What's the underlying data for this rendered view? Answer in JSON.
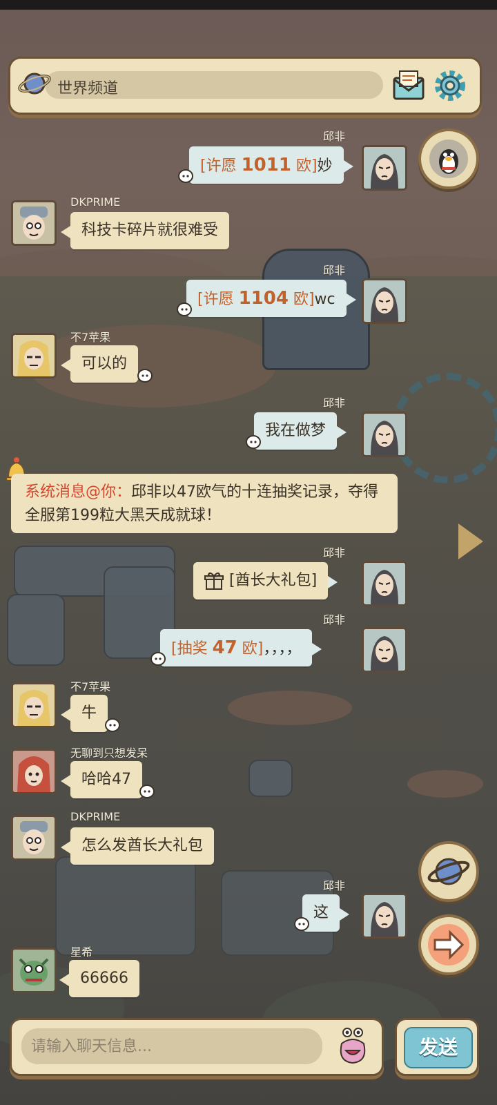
{
  "header": {
    "channel": "世界频道"
  },
  "messages": [
    {
      "sender": "邱非",
      "mine": true,
      "tag_open": "[许愿 ",
      "amount": "1011",
      "tag_close": " 欧]",
      "text": "妙"
    },
    {
      "sender": "DKPRIME",
      "mine": false,
      "text": "科技卡碎片就很难受"
    },
    {
      "sender": "邱非",
      "mine": true,
      "tag_open": "[许愿 ",
      "amount": "1104",
      "tag_close": " 欧]",
      "text": "wc"
    },
    {
      "sender": "不7苹果",
      "mine": false,
      "text": "可以的"
    },
    {
      "sender": "邱非",
      "mine": true,
      "text": "我在做梦"
    },
    {
      "sender": "邱非",
      "mine": true,
      "text": "[酋长大礼包]"
    },
    {
      "sender": "邱非",
      "mine": true,
      "tag_open": "[抽奖 ",
      "amount": "47",
      "tag_close": " 欧]",
      "text": "，，，，"
    },
    {
      "sender": "不7苹果",
      "mine": false,
      "text": "牛"
    },
    {
      "sender": "无聊到只想发呆",
      "mine": false,
      "text": "哈哈47"
    },
    {
      "sender": "DKPRIME",
      "mine": false,
      "text": "怎么发酋长大礼包"
    },
    {
      "sender": "邱非",
      "mine": true,
      "text": "这"
    },
    {
      "sender": "星希",
      "mine": false,
      "text": "66666"
    }
  ],
  "system": {
    "tag": "系统消息@你：",
    "text": "邱非以47欧气的十连抽奖记录，夺得全服第199粒大黑天成就球！"
  },
  "footer": {
    "placeholder": "请输入聊天信息...",
    "send_label": "发送"
  },
  "icons": {
    "header": [
      "planet-icon",
      "mail-icon",
      "gear-icon"
    ],
    "side": [
      "qq-penguin-icon",
      "planet-icon",
      "arrow-right-icon"
    ],
    "other": [
      "bell-icon",
      "emoji-icon",
      "gift-icon",
      "speech-bubble-icon"
    ]
  },
  "colors": {
    "panel": "#efe2bf",
    "mine_bubble": "#dcebe9",
    "highlight": "#c4602a",
    "system_tag": "#d4462d",
    "send_button": "#7ec4d2"
  }
}
